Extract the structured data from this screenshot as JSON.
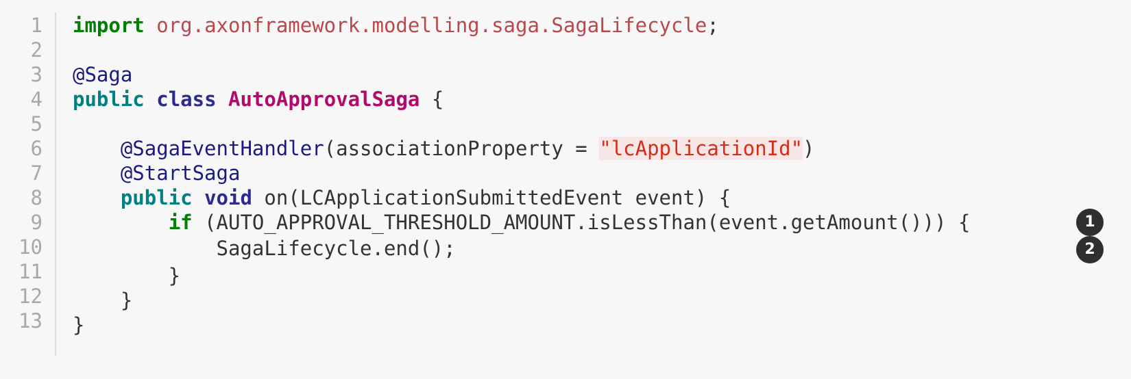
{
  "code": {
    "line_numbers": [
      "1",
      "2",
      "3",
      "4",
      "5",
      "6",
      "7",
      "8",
      "9",
      "10",
      "11",
      "12",
      "13"
    ],
    "line1": {
      "import_kw": "import",
      "package": "org.axonframework.modelling.saga.SagaLifecycle",
      "semicolon": ";"
    },
    "line3": {
      "annotation": "@Saga"
    },
    "line4": {
      "public_kw": "public",
      "class_kw": "class",
      "class_name": "AutoApprovalSaga",
      "brace": "{"
    },
    "line6": {
      "indent": "    ",
      "annotation": "@SagaEventHandler",
      "args_open": "(associationProperty = ",
      "string": "\"lcApplicationId\"",
      "args_close": ")"
    },
    "line7": {
      "indent": "    ",
      "annotation": "@StartSaga"
    },
    "line8": {
      "indent": "    ",
      "public_kw": "public",
      "void_kw": "void",
      "signature": "on(LCApplicationSubmittedEvent event) {"
    },
    "line9": {
      "indent": "        ",
      "if_kw": "if",
      "condition": "(AUTO_APPROVAL_THRESHOLD_AMOUNT.isLessThan(event.getAmount())) {"
    },
    "line10": {
      "indent": "            ",
      "statement": "SagaLifecycle.end();"
    },
    "line11": {
      "text": "        }"
    },
    "line12": {
      "text": "    }"
    },
    "line13": {
      "text": "}"
    }
  },
  "callouts": [
    "1",
    "2"
  ]
}
